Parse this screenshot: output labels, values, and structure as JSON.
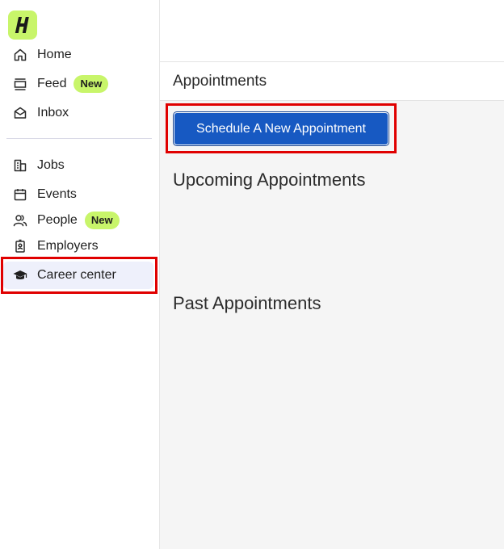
{
  "sidebar": {
    "logo_letter": "H",
    "items": [
      {
        "label": "Home",
        "icon": "home-icon"
      },
      {
        "label": "Feed",
        "icon": "feed-icon",
        "badge": "New"
      },
      {
        "label": "Inbox",
        "icon": "inbox-icon"
      },
      {
        "label": "Jobs",
        "icon": "jobs-icon"
      },
      {
        "label": "Events",
        "icon": "calendar-icon"
      },
      {
        "label": "People",
        "icon": "people-icon",
        "badge": "New"
      },
      {
        "label": "Employers",
        "icon": "employer-badge-icon"
      },
      {
        "label": "Career center",
        "icon": "graduation-cap-icon",
        "active": true
      }
    ]
  },
  "main": {
    "page_title": "Appointments",
    "schedule_button": "Schedule A New Appointment",
    "upcoming_heading": "Upcoming Appointments",
    "past_heading": "Past Appointments"
  },
  "colors": {
    "brand_lime": "#c8f56a",
    "primary_button": "#1759c2",
    "highlight": "#e00000",
    "active_nav_bg": "#eef0fb"
  }
}
